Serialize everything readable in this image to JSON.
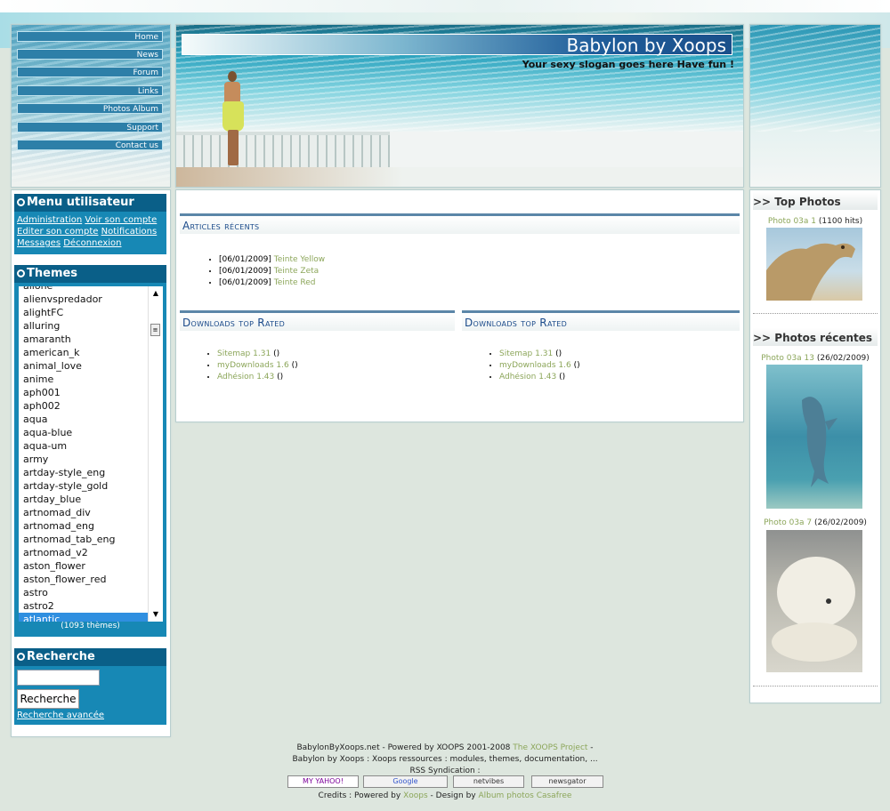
{
  "nav": {
    "items": [
      "Home",
      "News",
      "Forum",
      "Links",
      "Photos Album",
      "Support",
      "Contact us"
    ]
  },
  "header": {
    "title": "Babylon by Xoops",
    "slogan": "Your sexy slogan goes here Have fun !"
  },
  "user_menu": {
    "title": "Menu utilisateur",
    "links": [
      "Administration",
      "Voir son compte",
      "Editer son compte",
      "Notifications",
      "Messages",
      "Déconnexion"
    ]
  },
  "themes": {
    "title": "Themes",
    "items": [
      "alienvspredador",
      "alightFC",
      "alluring",
      "amaranth",
      "american_k",
      "animal_love",
      "anime",
      "aph001",
      "aph002",
      "aqua",
      "aqua-blue",
      "aqua-um",
      "army",
      "artday-style_eng",
      "artday-style_gold",
      "artday_blue",
      "artnomad_div",
      "artnomad_eng",
      "artnomad_tab_eng",
      "artnomad_v2",
      "aston_flower",
      "aston_flower_red",
      "astro",
      "astro2",
      "atlantic"
    ],
    "partial_top": "alione",
    "selected": "atlantic",
    "count": "(1093 thèmes)"
  },
  "search": {
    "title": "Recherche",
    "input_value": "",
    "button": "Recherche",
    "advanced": "Recherche avancée"
  },
  "articles": {
    "title": "Articles récents",
    "items": [
      {
        "date": "[06/01/2009]",
        "title": "Teinte Yellow"
      },
      {
        "date": "[06/01/2009]",
        "title": "Teinte Zeta"
      },
      {
        "date": "[06/01/2009]",
        "title": "Teinte Red"
      }
    ]
  },
  "downloads_left": {
    "title": "Downloads top Rated",
    "items": [
      {
        "name": "Sitemap 1.31",
        "rating": "()"
      },
      {
        "name": "myDownloads 1.6",
        "rating": "()"
      },
      {
        "name": "Adhésion 1.43",
        "rating": "()"
      }
    ]
  },
  "downloads_right": {
    "title": "Downloads top Rated",
    "items": [
      {
        "name": "Sitemap 1.31",
        "rating": "()"
      },
      {
        "name": "myDownloads 1.6",
        "rating": "()"
      },
      {
        "name": "Adhésion 1.43",
        "rating": "()"
      }
    ]
  },
  "top_photos": {
    "title": ">> Top Photos",
    "photo_title": "Photo 03a 1",
    "hits": "(1100 hits)"
  },
  "recent_photos": {
    "title": ">> Photos récentes",
    "items": [
      {
        "title": "Photo 03a 13",
        "date": "(26/02/2009)"
      },
      {
        "title": "Photo 03a 7",
        "date": "(26/02/2009)"
      }
    ]
  },
  "footer": {
    "line1_a": "BabylonByXoops.net - Powered by XOOPS 2001-2008 ",
    "line1_link": "The XOOPS Project",
    "line1_b": " -",
    "line2": "Babylon by Xoops : Xoops ressources : modules, themes, documentation, ...",
    "line3": "RSS Syndication :",
    "badges": [
      "MY YAHOO!",
      "Google",
      "netvibes",
      "newsgator"
    ],
    "credits_a": "Credits : Powered by ",
    "credits_link1": "Xoops",
    "credits_b": " - Design by ",
    "credits_link2": "Album photos Casafree"
  }
}
